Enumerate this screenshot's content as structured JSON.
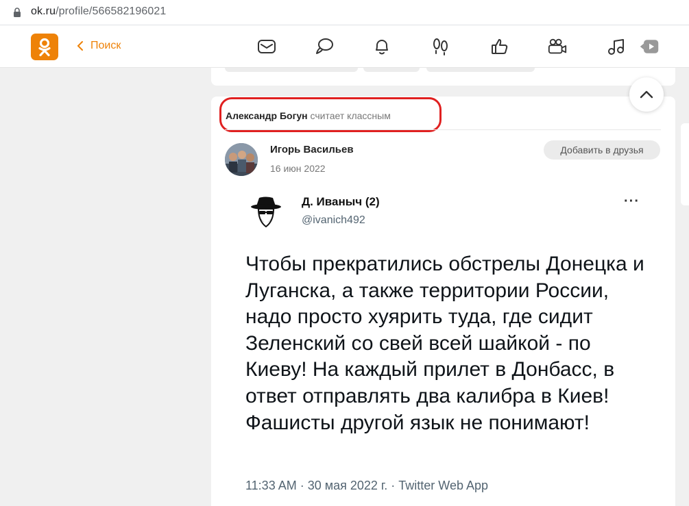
{
  "browser": {
    "url_host": "ok.ru",
    "url_path": "/profile/566582196021"
  },
  "nav": {
    "back_label": "Поиск",
    "icons": [
      "mail-icon",
      "chat-icon",
      "bell-icon",
      "footprints-icon",
      "like-icon",
      "video-camera-icon",
      "music-icon",
      "video-play-icon"
    ]
  },
  "feed": {
    "activity": {
      "who": "Александр Богун",
      "action": "считает классным"
    },
    "post": {
      "author": "Игорь Васильев",
      "date": "16 июн 2022",
      "add_friend_label": "Добавить в друзья"
    },
    "tweet": {
      "name": "Д. Иваныч (2)",
      "handle": "@ivanich492",
      "more": "···",
      "text": "Чтобы прекратились обстрелы Донецка и Луганска, а также территории России, надо просто хуярить туда, где сидит Зеленский со свей всей шайкой - по Киеву! На каждый прилет в Донбасс, в ответ отправлять два калибра в Киев! Фашисты другой язык не понимают!",
      "meta": "11:33 AM · 30 мая 2022 г. · Twitter Web App"
    }
  },
  "colors": {
    "brand": "#ee8208",
    "highlight": "#e02020"
  }
}
